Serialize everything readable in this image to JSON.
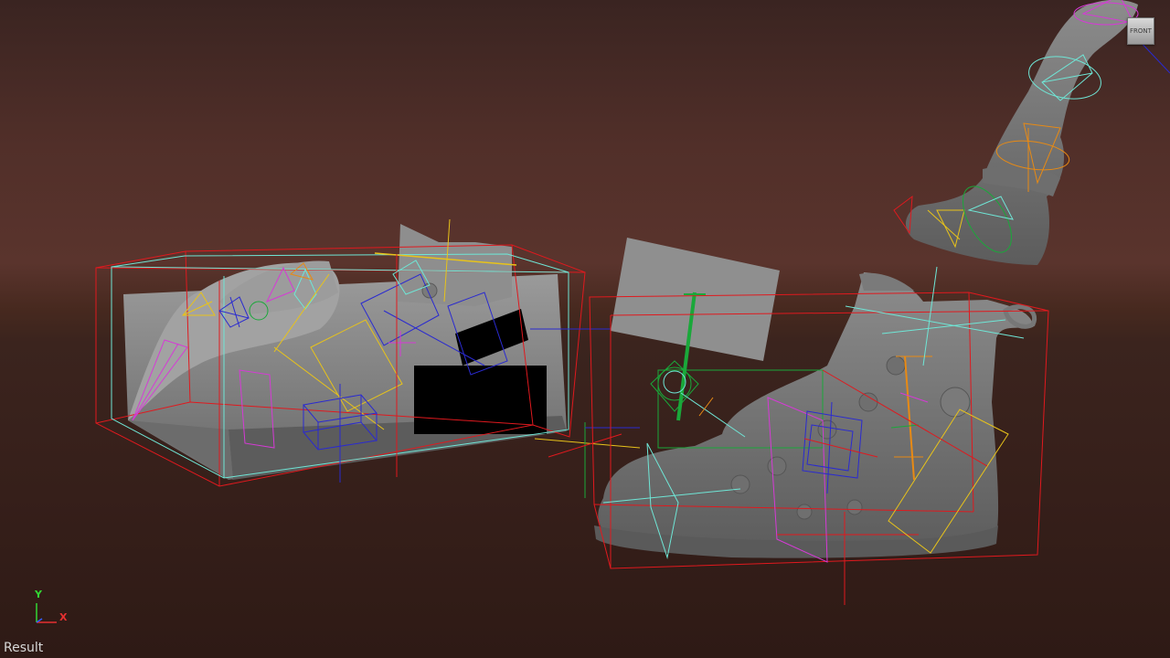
{
  "viewport": {
    "view_cube_label": "FRONT",
    "view_name": "Result",
    "axis": {
      "y_label": "Y",
      "x_label": "X"
    }
  },
  "colors": {
    "bbox": "#e0191e",
    "cyan": "#6fe6d6",
    "yellow": "#e8c31a",
    "magenta": "#d63ad6",
    "blue": "#2a2ad0",
    "green": "#1aa83a",
    "orange": "#e88a14",
    "mesh": "#8a8a8a"
  }
}
